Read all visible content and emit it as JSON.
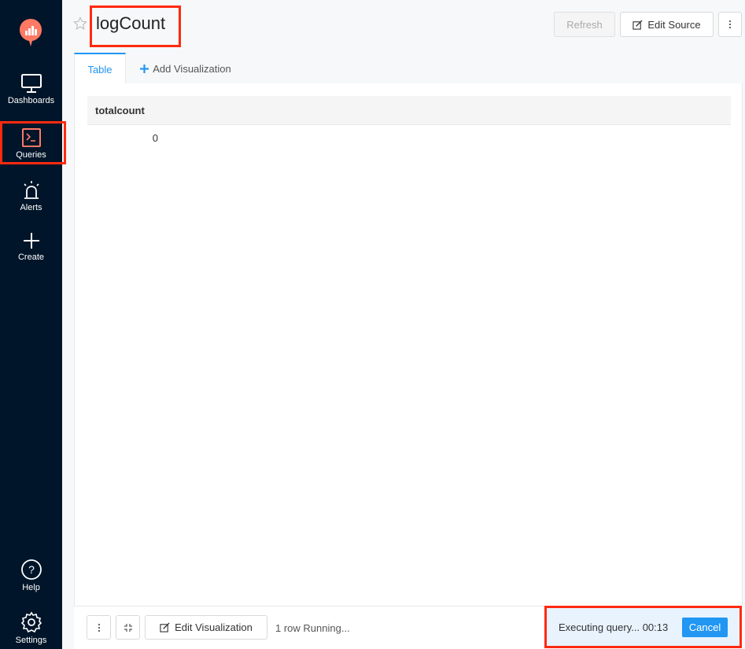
{
  "sidebar": {
    "items": [
      {
        "label": "Dashboards",
        "icon": "monitor-icon"
      },
      {
        "label": "Queries",
        "icon": "terminal-icon"
      },
      {
        "label": "Alerts",
        "icon": "alarm-icon"
      },
      {
        "label": "Create",
        "icon": "plus-icon"
      }
    ],
    "bottom": [
      {
        "label": "Help",
        "icon": "help-icon"
      },
      {
        "label": "Settings",
        "icon": "gear-icon"
      }
    ]
  },
  "header": {
    "title": "logCount",
    "refresh_label": "Refresh",
    "edit_source_label": "Edit Source"
  },
  "tabs": [
    {
      "label": "Table"
    },
    {
      "label": "Add Visualization"
    }
  ],
  "table": {
    "columns": [
      "totalcount"
    ],
    "rows": [
      [
        "0"
      ]
    ]
  },
  "footer": {
    "edit_visualization_label": "Edit Visualization",
    "row_count": "1 row",
    "status": "Running...",
    "executing_text": "Executing query... 00:13",
    "cancel_label": "Cancel"
  },
  "colors": {
    "sidebar_bg": "#001529",
    "accent": "#2196f3",
    "highlight": "#ff2a10",
    "logo": "#ff7964"
  }
}
